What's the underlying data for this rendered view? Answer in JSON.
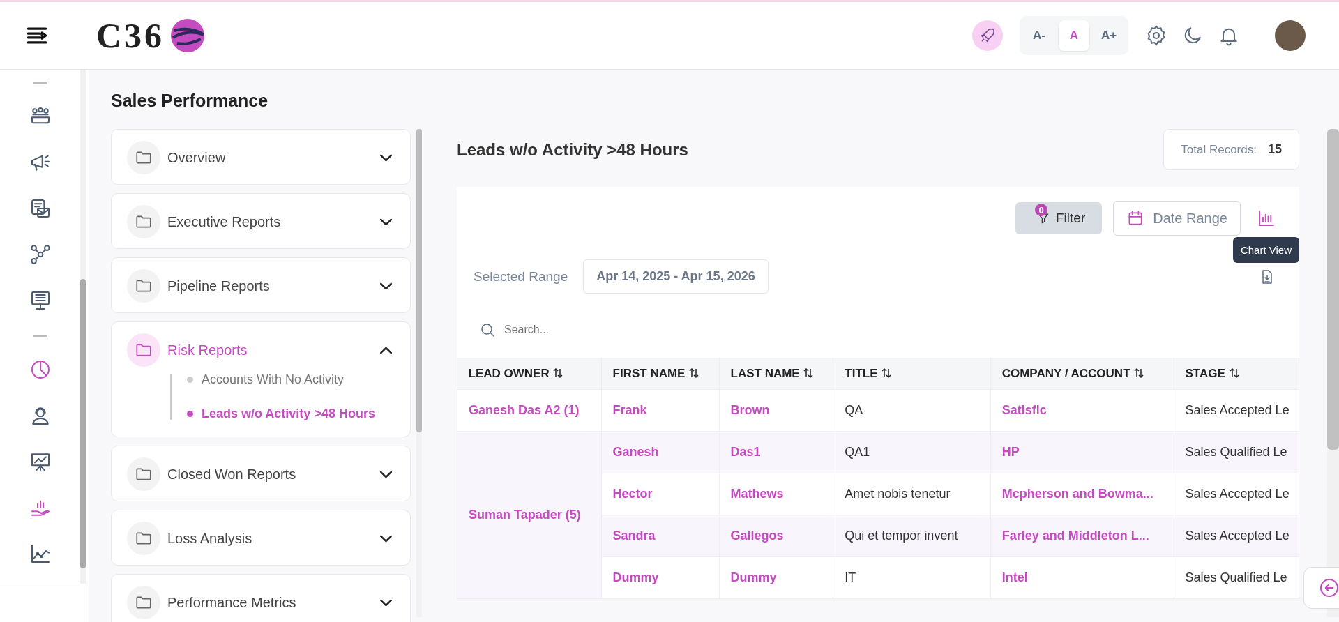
{
  "header": {
    "logo_text": "C36",
    "font_sizes": [
      {
        "label": "A-",
        "selected": false
      },
      {
        "label": "A",
        "selected": true
      },
      {
        "label": "A+",
        "selected": false
      }
    ]
  },
  "rail": [
    {
      "selected": false
    },
    {
      "selected": false
    },
    {
      "selected": false
    },
    {
      "selected": false
    },
    {
      "selected": false
    },
    {
      "selected": true
    },
    {
      "selected": false
    },
    {
      "selected": false
    },
    {
      "selected": true
    },
    {
      "selected": false
    }
  ],
  "page_title": "Sales Performance",
  "report_groups": [
    {
      "label": "Overview",
      "expanded": false
    },
    {
      "label": "Executive Reports",
      "expanded": false
    },
    {
      "label": "Pipeline Reports",
      "expanded": false
    },
    {
      "label": "Risk Reports",
      "expanded": true,
      "children": [
        {
          "label": "Accounts With No Activity",
          "selected": false
        },
        {
          "label": "Leads w/o Activity >48 Hours",
          "selected": true
        }
      ]
    },
    {
      "label": "Closed Won Reports",
      "expanded": false
    },
    {
      "label": "Loss Analysis",
      "expanded": false
    },
    {
      "label": "Performance Metrics",
      "expanded": false
    }
  ],
  "report": {
    "title": "Leads w/o Activity >48 Hours",
    "total_label": "Total Records:",
    "total": "15",
    "filter": {
      "label": "Filter",
      "count": "0"
    },
    "date_range_button": "Date Range",
    "chart_tooltip": "Chart View",
    "selected_range_label": "Selected Range",
    "selected_range": "Apr 14, 2025 - Apr 15, 2026",
    "search": {
      "placeholder": "Search..."
    }
  },
  "table": {
    "columns": [
      "LEAD OWNER",
      "FIRST NAME",
      "LAST NAME",
      "TITLE",
      "COMPANY / ACCOUNT",
      "STAGE"
    ],
    "groups": [
      {
        "owner": "Ganesh Das A2 (1)",
        "rows": [
          {
            "first": "Frank",
            "last": "Brown",
            "title": "QA",
            "company": "Satisfic",
            "stage": "Sales Accepted Le"
          }
        ]
      },
      {
        "owner": "Suman Tapader (5)",
        "rows": [
          {
            "first": "Ganesh",
            "last": "Das1",
            "title": "QA1",
            "company": "HP",
            "stage": "Sales Qualified Le"
          },
          {
            "first": "Hector",
            "last": "Mathews",
            "title": "Amet nobis tenetur",
            "company": "Mcpherson and Bowma...",
            "stage": "Sales Accepted Le"
          },
          {
            "first": "Sandra",
            "last": "Gallegos",
            "title": "Qui et tempor invent",
            "company": "Farley and Middleton L...",
            "stage": "Sales Accepted Le"
          },
          {
            "first": "Dummy",
            "last": "Dummy",
            "title": "IT",
            "company": "Intel",
            "stage": "Sales Qualified Le"
          }
        ]
      }
    ]
  }
}
